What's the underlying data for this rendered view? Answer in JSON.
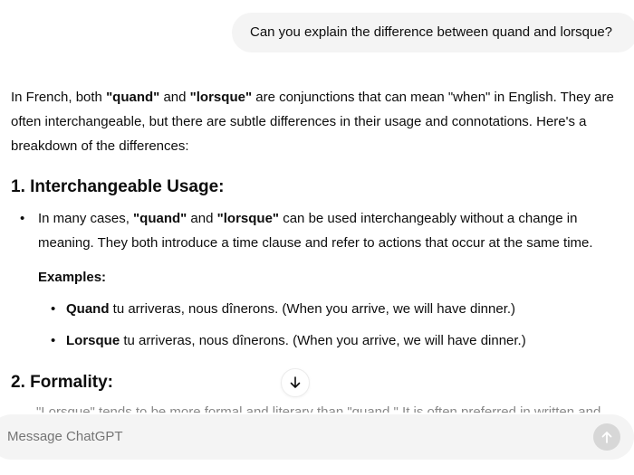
{
  "conversation": {
    "user_message": "Can you explain the difference between quand and lorsque?",
    "assistant": {
      "intro": {
        "t1": "In French, both ",
        "b1": "\"quand\"",
        "t2": " and ",
        "b2": "\"lorsque\"",
        "t3": " are conjunctions that can mean \"when\" in English. They are often interchangeable, but there are subtle differences in their usage and connotations. Here's a breakdown of the differences:"
      },
      "sections": [
        {
          "heading": "1. Interchangeable Usage:",
          "bullet": {
            "t1": "In many cases, ",
            "b1": "\"quand\"",
            "t2": " and ",
            "b2": "\"lorsque\"",
            "t3": " can be used interchangeably without a change in meaning. They both introduce a time clause and refer to actions that occur at the same time."
          },
          "examples_label": "Examples:",
          "examples": [
            {
              "bold": "Quand",
              "rest": " tu arriveras, nous dînerons. (When you arrive, we will have dinner.)"
            },
            {
              "bold": "Lorsque",
              "rest": " tu arriveras, nous dînerons. (When you arrive, we will have dinner.)"
            }
          ]
        },
        {
          "heading": "2. Formality:",
          "partial_text": "\"Lorsque\" tends to be more formal and literary than \"quand.\" It is often preferred in written and"
        }
      ]
    }
  },
  "composer": {
    "placeholder": "Message ChatGPT",
    "send_icon": "arrow-up-icon"
  },
  "scroll_button": {
    "icon": "arrow-down-icon"
  },
  "colors": {
    "bubble_bg": "#f4f4f4",
    "send_disabled": "#d7d7d7",
    "text": "#0d0d0d"
  }
}
